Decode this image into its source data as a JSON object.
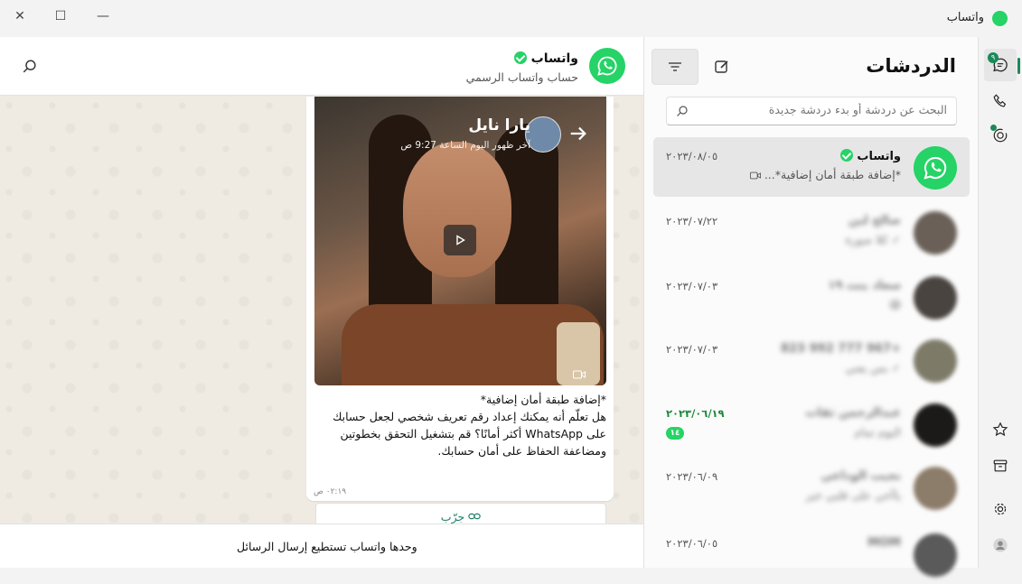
{
  "window": {
    "app_title": "واتساب",
    "close_glyph": "✕",
    "maximize_glyph": "☐",
    "minimize_glyph": "—"
  },
  "rail": {
    "chats_badge": "٩"
  },
  "chat_list": {
    "title": "الدردشات",
    "search_placeholder": "البحث عن دردشة أو بدء دردشة جديدة",
    "chats": [
      {
        "name": "واتساب",
        "date": "٢٠٢٣/٠٨/٠٥",
        "preview": "*إضافة طبقة أمان إضافية*...",
        "verified": true
      },
      {
        "name": "صالح لبن",
        "date": "٢٠٢٣/٠٧/٢٢",
        "preview": "✓ كلا صورة"
      },
      {
        "name": "سعاد بنت ١٩",
        "date": "٢٠٢٣/٠٧/٠٣",
        "preview": "😅"
      },
      {
        "name": "+967 777 992 823",
        "date": "٢٠٢٣/٠٧/٠٣",
        "preview": "✓ بس يعني"
      },
      {
        "name": "عبدالرحمن ثقات",
        "date": "٢٠٢٣/٠٦/١٩",
        "preview": "اليوم تمام",
        "unread_count": "١٤"
      },
      {
        "name": "نجيب الوداعي",
        "date": "٢٠٢٣/٠٦/٠٩",
        "preview": "ياأخي على قلبي خير"
      },
      {
        "name": "MOM",
        "date": "٢٠٢٣/٠٦/٠٥",
        "preview": ""
      }
    ]
  },
  "conversation": {
    "name": "واتساب",
    "subtitle": "حساب واتساب الرسمي",
    "video": {
      "overlay_name": "يارا نايل",
      "overlay_sub": "آخر ظهور اليوم الساعة 9:27 ص"
    },
    "message_text": "*إضافة طبقة أمان إضافية*\nهل تعلّم أنه يمكنك إعداد رقم تعريف شخصي لجعل حسابك على WhatsApp أكثر أمانًا؟ قم بتشغيل التحقق بخطوتين ومضاعفة الحفاظ على أمان حسابك.",
    "message_time": "٠٢:١٩ ص",
    "join_label": "جرّب",
    "footer_text": "وحدها واتساب تستطيع إرسال الرسائل"
  },
  "colors": {
    "brand": "#25d366",
    "accent": "#1a8a5a"
  },
  "icons": [
    "close-icon",
    "maximize-icon",
    "minimize-icon",
    "whatsapp-logo",
    "chats-icon",
    "calls-icon",
    "status-icon",
    "starred-icon",
    "archive-icon",
    "settings-icon",
    "profile-icon",
    "new-chat-icon",
    "filter-icon",
    "search-icon",
    "play-icon",
    "link-icon",
    "arrow-icon",
    "video-camera-icon"
  ]
}
